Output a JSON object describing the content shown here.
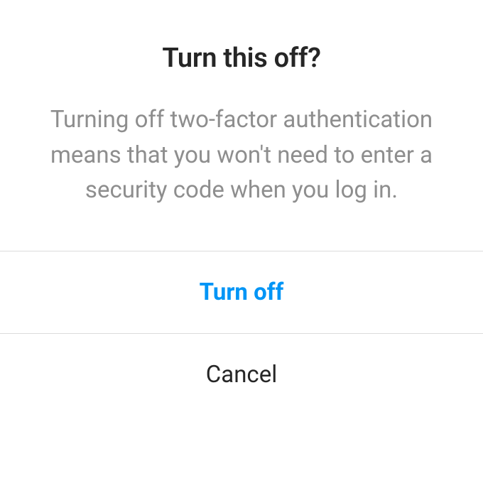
{
  "dialog": {
    "title": "Turn this off?",
    "body": "Turning off two-factor authentication means that you won't need to enter a security code when you log in.",
    "confirm_label": "Turn off",
    "cancel_label": "Cancel"
  }
}
